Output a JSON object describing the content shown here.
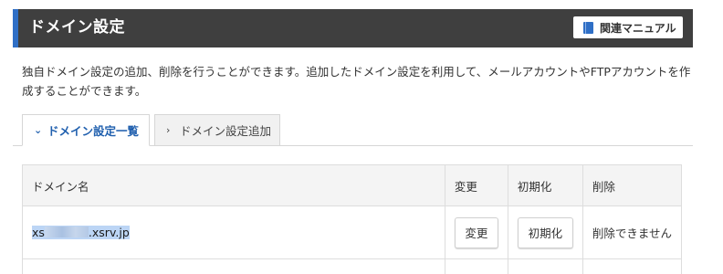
{
  "header": {
    "title": "ドメイン設定",
    "manual_button": "関連マニュアル",
    "manual_icon": "book-icon"
  },
  "description": "独自ドメイン設定の追加、削除を行うことができます。追加したドメイン設定を利用して、メールアカウントやFTPアカウントを作成することができます。",
  "tabs": [
    {
      "label": "ドメイン設定一覧",
      "icon": "chevron-down-icon",
      "active": true
    },
    {
      "label": "ドメイン設定追加",
      "icon": "chevron-right-icon",
      "active": false
    }
  ],
  "table": {
    "columns": [
      "ドメイン名",
      "変更",
      "初期化",
      "削除"
    ],
    "rows": [
      {
        "domain_prefix": "xs",
        "domain_suffix": ".xsrv.jp",
        "change_button": "変更",
        "init_button": "初期化",
        "delete_status": "削除できません"
      }
    ]
  },
  "colors": {
    "header_bg": "#3f3f3f",
    "accent_blue": "#2f6fc6",
    "active_tab_text": "#1f5fae",
    "selection_highlight": "#bcd5f5"
  }
}
